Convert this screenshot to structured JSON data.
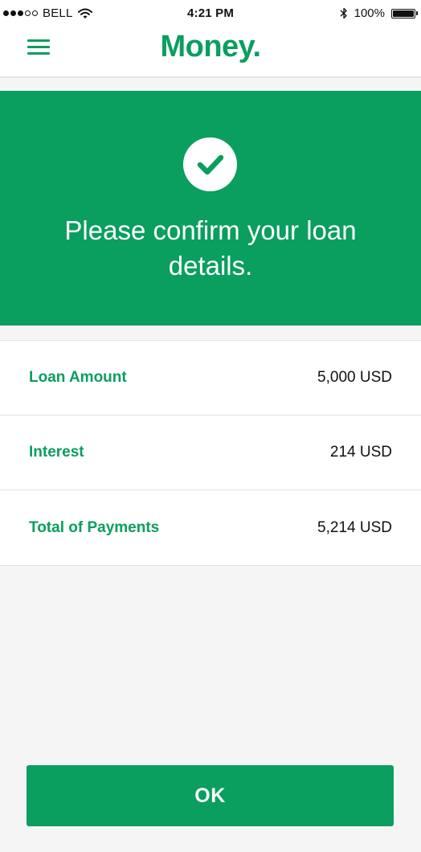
{
  "status_bar": {
    "carrier": "BELL",
    "time": "4:21 PM",
    "battery_percent": "100%",
    "signal_bars_filled": 3,
    "signal_bars_total": 5,
    "battery_level": 1.0,
    "icons": [
      "signal-icon",
      "wifi-icon",
      "bluetooth-icon",
      "battery-icon"
    ]
  },
  "header": {
    "brand": "Money.",
    "menu_icon": "hamburger-menu-icon"
  },
  "hero": {
    "icon": "check-circle-icon",
    "title": "Please confirm your loan details."
  },
  "details": {
    "rows": [
      {
        "label": "Loan Amount",
        "value": "5,000 USD"
      },
      {
        "label": "Interest",
        "value": "214 USD"
      },
      {
        "label": "Total of Payments",
        "value": "5,214 USD"
      }
    ]
  },
  "actions": {
    "ok_label": "OK"
  },
  "colors": {
    "brand_green": "#0a9e5f",
    "background": "#f5f5f5",
    "surface": "#ffffff",
    "text": "#111111"
  }
}
